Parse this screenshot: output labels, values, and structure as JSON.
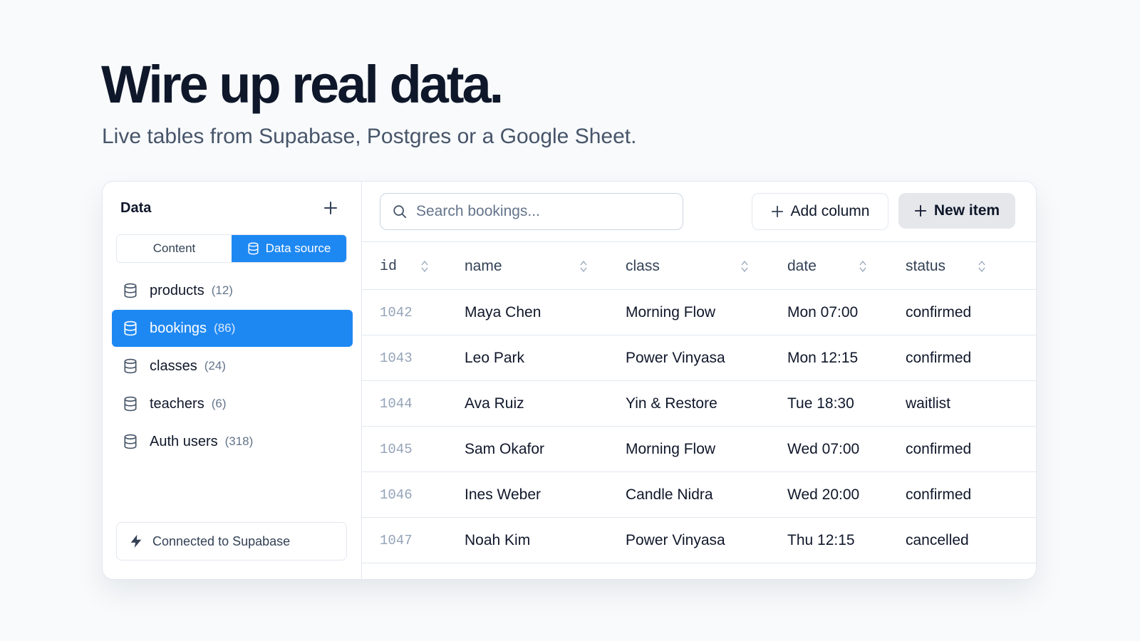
{
  "hero": {
    "title": "Wire up real data.",
    "subtitle": "Live tables from Supabase, Postgres or a Google Sheet."
  },
  "sidebar": {
    "title": "Data",
    "add_icon": "plus-icon",
    "tabs": [
      {
        "label": "Content",
        "active": false
      },
      {
        "label": "Data source",
        "active": true,
        "icon": "database-icon"
      }
    ],
    "tables": [
      {
        "name": "products",
        "count": "(12)",
        "active": false
      },
      {
        "name": "bookings",
        "count": "(86)",
        "active": true
      },
      {
        "name": "classes",
        "count": "(24)",
        "active": false
      },
      {
        "name": "teachers",
        "count": "(6)",
        "active": false
      },
      {
        "name": "Auth users",
        "count": "(318)",
        "active": false
      }
    ],
    "connection": {
      "label": "Connected to Supabase",
      "icon": "bolt-icon"
    }
  },
  "toolbar": {
    "search_placeholder": "Search bookings...",
    "add_column_label": "Add column",
    "new_item_label": "New item"
  },
  "table": {
    "columns": [
      "id",
      "name",
      "class",
      "date",
      "status"
    ],
    "rows": [
      {
        "id": "1042",
        "name": "Maya Chen",
        "class": "Morning Flow",
        "date": "Mon 07:00",
        "status": "confirmed"
      },
      {
        "id": "1043",
        "name": "Leo Park",
        "class": "Power Vinyasa",
        "date": "Mon 12:15",
        "status": "confirmed"
      },
      {
        "id": "1044",
        "name": "Ava Ruiz",
        "class": "Yin & Restore",
        "date": "Tue 18:30",
        "status": "waitlist"
      },
      {
        "id": "1045",
        "name": "Sam Okafor",
        "class": "Morning Flow",
        "date": "Wed 07:00",
        "status": "confirmed"
      },
      {
        "id": "1046",
        "name": "Ines Weber",
        "class": "Candle Nidra",
        "date": "Wed 20:00",
        "status": "confirmed"
      },
      {
        "id": "1047",
        "name": "Noah Kim",
        "class": "Power Vinyasa",
        "date": "Thu 12:15",
        "status": "cancelled"
      }
    ]
  },
  "colors": {
    "accent": "#1e88f2",
    "title": "#0f172a",
    "muted": "#64748b",
    "border": "#e2e8f0"
  }
}
